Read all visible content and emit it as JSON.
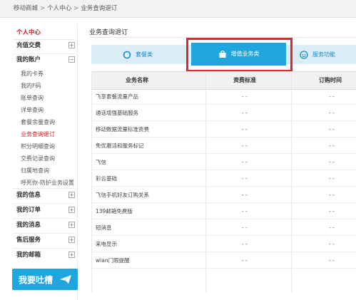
{
  "breadcrumb": {
    "home": "移动商城",
    "sep": ">",
    "personal": "个人中心",
    "current": "业务查询退订"
  },
  "sidebar": {
    "title": "个人中心",
    "groups": [
      {
        "label": "充值交费",
        "toggle": "+"
      },
      {
        "label": "我的账户",
        "toggle": "−"
      },
      {
        "label": "我的信息",
        "toggle": "+"
      },
      {
        "label": "我的订单",
        "toggle": "+"
      },
      {
        "label": "我的消息",
        "toggle": "+"
      },
      {
        "label": "售后服务",
        "toggle": "+"
      },
      {
        "label": "我的邮箱",
        "toggle": "+"
      }
    ],
    "account_items": [
      "我的卡券",
      "我的F码",
      "账单查询",
      "详单查询",
      "套餐余量查询",
      "业务查询退订",
      "积分明细查询",
      "交费记录查询",
      "归属地查询",
      "呼死你-防护业务设置"
    ],
    "active_item": "业务查询退订",
    "promo": "我要吐槽"
  },
  "main": {
    "title": "业务查询退订",
    "tabs": [
      {
        "label": "套餐类",
        "icon": "circle-icon"
      },
      {
        "label": "增值业务类",
        "icon": "bag-icon"
      },
      {
        "label": "服务功能",
        "icon": "service-icon"
      }
    ],
    "active_tab": "增值业务类"
  },
  "table": {
    "headers": [
      "业务名称",
      "资费标准",
      "订购时间"
    ],
    "rows": [
      {
        "name": "飞享套餐流量产品",
        "fee": "- -",
        "time": "- -"
      },
      {
        "name": "通话增强基础服务",
        "fee": "- -",
        "time": "- -"
      },
      {
        "name": "移动数据流量标准资费",
        "fee": "- -",
        "time": "- -"
      },
      {
        "name": "免优惠活和服务标记",
        "fee": "- -",
        "time": "- -"
      },
      {
        "name": "飞信",
        "fee": "- -",
        "time": "- -"
      },
      {
        "name": "彩云基础",
        "fee": "- -",
        "time": "- -"
      },
      {
        "name": "飞信手机好友订购关系",
        "fee": "- -",
        "time": "- -"
      },
      {
        "name": "139邮箱免费版",
        "fee": "- -",
        "time": "- -"
      },
      {
        "name": "短消息",
        "fee": "- -",
        "time": "- -"
      },
      {
        "name": "来电显示",
        "fee": "- -",
        "time": "- -"
      },
      {
        "name": "wlan门限提醒",
        "fee": "- -",
        "time": "- -"
      }
    ]
  },
  "colors": {
    "accent_red": "#d6181e",
    "tab_blue": "#1fa6df",
    "tabbar_bg": "#dbeef7",
    "highlight_red": "#e0282d"
  }
}
